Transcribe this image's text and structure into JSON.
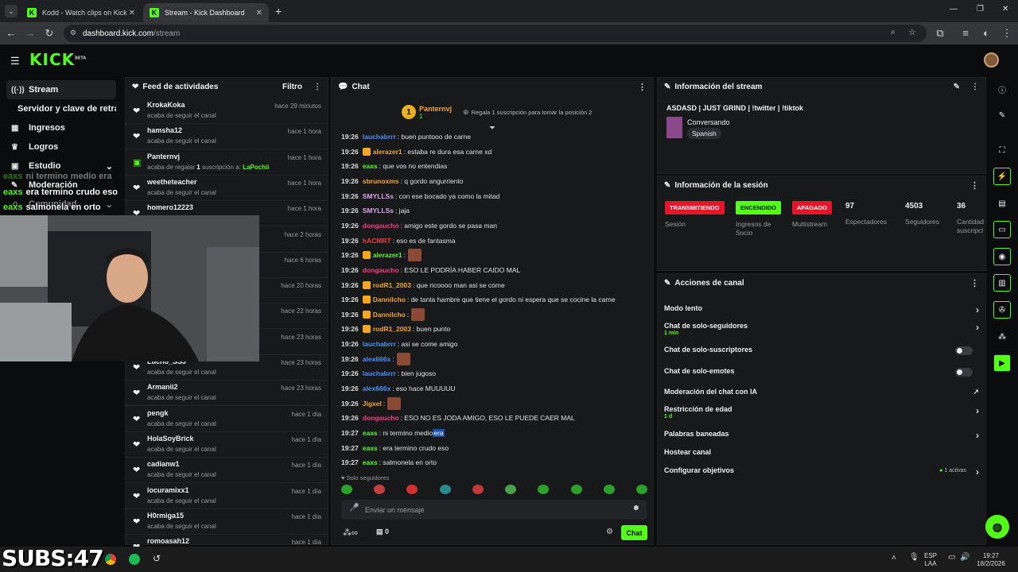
{
  "browser": {
    "tabs": [
      {
        "title": "Kodd - Watch clips on Kick"
      },
      {
        "title": "Stream - Kick Dashboard"
      }
    ],
    "url_host": "dashboard.kick.com",
    "url_path": "/stream"
  },
  "brand": {
    "logo": "KICK",
    "logo_badge": "BETA",
    "accent": "#53fc18"
  },
  "nav": {
    "items": [
      {
        "label": "Stream",
        "icon": "broadcast-icon"
      },
      {
        "label": "Servidor y clave de retransm"
      },
      {
        "label": "Ingresos",
        "icon": "chart-icon"
      },
      {
        "label": "Logros",
        "icon": "trophy-icon"
      },
      {
        "label": "Estudio",
        "icon": "studio-icon"
      },
      {
        "label": "Moderación",
        "icon": "shield-icon"
      },
      {
        "label": "Comunidad",
        "icon": "community-icon"
      }
    ]
  },
  "feed": {
    "title": "Feed de actividades",
    "filter": "Filtro",
    "items": [
      {
        "name": "KrokaKoka",
        "desc": "acaba de seguir el canal",
        "time": "hace 29 minutos"
      },
      {
        "name": "hamsha12",
        "desc": "acaba de seguir el canal",
        "time": "hace 1 hora"
      },
      {
        "name": "Panternvj",
        "desc_pre": "acaba de regalar ",
        "desc_count": "1",
        "desc_mid": " suscripción a: ",
        "desc_target": "LaPochii",
        "time": "hace 1 hora"
      },
      {
        "name": "weetheteacher",
        "desc": "acaba de seguir el canal",
        "time": "hace 1 hora"
      },
      {
        "name": "homero12223",
        "desc": "",
        "time": "hace 1 hora"
      },
      {
        "name": "",
        "desc": "",
        "time": "hace 2 horas"
      },
      {
        "name": "",
        "desc": "",
        "time": "hace 6 horas"
      },
      {
        "name": "",
        "desc": "",
        "time": "hace 20 horas"
      },
      {
        "name": "",
        "desc": "",
        "time": "hace 22 horas"
      },
      {
        "name": "",
        "desc": "",
        "time": "hace 23 horas"
      },
      {
        "name": "Lucho_SSJ",
        "desc": "acaba de seguir el canal",
        "time": "hace 23 horas"
      },
      {
        "name": "Armanii2",
        "desc": "acaba de seguir el canal",
        "time": "hace 23 horas"
      },
      {
        "name": "pengk",
        "desc": "acaba de seguir el canal",
        "time": "hace 1 día"
      },
      {
        "name": "HolaSoyBrick",
        "desc": "acaba de seguir el canal",
        "time": "hace 1 día"
      },
      {
        "name": "cadianw1",
        "desc": "acaba de seguir el canal",
        "time": "hace 1 día"
      },
      {
        "name": "locuramixx1",
        "desc": "acaba de seguir el canal",
        "time": "hace 1 día"
      },
      {
        "name": "H0rmiga15",
        "desc": "acaba de seguir el canal",
        "time": "hace 1 día"
      },
      {
        "name": "romoasah12",
        "desc": "",
        "time": "hace 1 día"
      }
    ]
  },
  "chat": {
    "title": "Chat",
    "top_gifter": {
      "name": "Panternvj",
      "rank": "1",
      "count": "1",
      "cta": "Regala 1 suscripción para tomar la posición 2"
    },
    "messages": [
      {
        "time": "19:26",
        "user": "lauchabrrr",
        "color": "#4f8ff7",
        "text": ": buen puntooo de carne"
      },
      {
        "time": "19:26",
        "user": "alerazer1",
        "color": "#f5a623",
        "text": ": estaba re dura esa carne xd",
        "badge": true
      },
      {
        "time": "19:26",
        "user": "eaxs",
        "color": "#53fc18",
        "text": ": que vos no entendias"
      },
      {
        "time": "19:26",
        "user": "sbrunoxms",
        "color": "#f5a623",
        "text": ": q gordo angurriento"
      },
      {
        "time": "19:26",
        "user": "SMYLLSs",
        "color": "#e0a0f0",
        "text": ": con ese bocado ya como la mitad"
      },
      {
        "time": "19:26",
        "user": "SMYLLSs",
        "color": "#e0a0f0",
        "text": ": jaja"
      },
      {
        "time": "19:26",
        "user": "dongaucho",
        "color": "#f04080",
        "text": ": amigo este gordo se pasa man"
      },
      {
        "time": "19:26",
        "user": "hACMRT",
        "color": "#f04040",
        "text": ": eso es de fantasma"
      },
      {
        "time": "19:26",
        "user": "alerazer1",
        "color": "#53fc18",
        "text": ":",
        "badge": true,
        "emote": true
      },
      {
        "time": "19:26",
        "user": "dongaucho",
        "color": "#f04080",
        "text": ": ESO LE PODRÍA HABER CAIDO MAL"
      },
      {
        "time": "19:26",
        "user": "rodR1_2003",
        "color": "#f5a623",
        "text": ": que ricoooo man asi se come",
        "badge": true
      },
      {
        "time": "19:26",
        "user": "Dannilcho",
        "color": "#f5a623",
        "text": ": de tanta hambre que tiene el gordo ni espera que se cocine la carne",
        "badge": true
      },
      {
        "time": "19:26",
        "user": "Dannilcho",
        "color": "#f5a623",
        "text": ":",
        "badge": true,
        "emote": true
      },
      {
        "time": "19:26",
        "user": "rodR1_2003",
        "color": "#f5a623",
        "text": ": buen punto",
        "badge": true
      },
      {
        "time": "19:26",
        "user": "lauchabrrr",
        "color": "#4f8ff7",
        "text": ": asi se come amigo"
      },
      {
        "time": "19:26",
        "user": "alex666x",
        "color": "#4f8ff7",
        "text": ":",
        "emote": true
      },
      {
        "time": "19:26",
        "user": "lauchabrrr",
        "color": "#4f8ff7",
        "text": ": bien jugoso"
      },
      {
        "time": "19:26",
        "user": "alex666x",
        "color": "#4f8ff7",
        "text": ": eso hace MUUUUU"
      },
      {
        "time": "19:26",
        "user": "Jigxel",
        "color": "#f5a623",
        "text": ":",
        "emote": true
      },
      {
        "time": "19:26",
        "user": "dongaucho",
        "color": "#f04080",
        "text": ": ESO NO ES JODA AMIGO, ESO LE PUEDE CAER MAL"
      },
      {
        "time": "19:27",
        "user": "eaxs",
        "color": "#53fc18",
        "text": ": ni termino medio ",
        "highlight": "era"
      },
      {
        "time": "19:27",
        "user": "eaxs",
        "color": "#53fc18",
        "text": ": era termino crudo eso"
      },
      {
        "time": "19:27",
        "user": "eaxs",
        "color": "#53fc18",
        "text": ": salmonela en orto"
      }
    ],
    "mode_label": "Solo seguidores",
    "input_placeholder": "Enviar un mensaje",
    "infinity": "∞",
    "gift_count": "0",
    "send": "Chat"
  },
  "stream_info": {
    "title": "Información del stream",
    "stream_title": "ASDASD | JUST GRIND | !twitter | !tiktok",
    "category": "Conversando",
    "language": "Spanish"
  },
  "session": {
    "title": "Información de la sesión",
    "badges": [
      {
        "text": "TRANSMITIENDO",
        "label": "Sesión",
        "bg": "#e3172b",
        "fg": "#ffffff"
      },
      {
        "text": "ENCENDIDO",
        "label": "Ingresos de Socio",
        "bg": "#53fc18",
        "fg": "#000000"
      },
      {
        "text": "APAGADO",
        "label": "Multistream",
        "bg": "#e3172b",
        "fg": "#ffffff"
      }
    ],
    "stats": [
      {
        "value": "97",
        "label": "Espectadores"
      },
      {
        "value": "4503",
        "label": "Seguidores"
      },
      {
        "value": "36",
        "label": "Cantidad suscripci"
      }
    ]
  },
  "actions": {
    "title": "Acciones de canal",
    "items": [
      {
        "label": "Modo lento",
        "type": "chevron"
      },
      {
        "label": "Chat de solo-seguidores",
        "sub": "1 min",
        "type": "chevron"
      },
      {
        "label": "Chat de solo-suscriptores",
        "type": "toggle"
      },
      {
        "label": "Chat de solo-emotes",
        "type": "toggle"
      },
      {
        "label": "Moderación del chat con IA",
        "type": "external"
      },
      {
        "label": "Restricción de edad",
        "sub": "1 d",
        "type": "chevron"
      },
      {
        "label": "Palabras baneadas",
        "type": "chevron"
      },
      {
        "label": "Hostear canal",
        "type": "none"
      },
      {
        "label": "Configurar objetivos",
        "type": "chevron",
        "status": "1 activas"
      }
    ]
  },
  "overlay": {
    "lines": [
      {
        "user": "eaxs",
        "sep": ": ",
        "text": "ni termino medio era"
      },
      {
        "user": "eaxs",
        "sep": ": ",
        "text": "era termino crudo eso"
      },
      {
        "user": "eaxs",
        "sep": ": ",
        "text": "salmonela en orto"
      }
    ],
    "subs": "SUBS:47"
  },
  "taskbar": {
    "lang": "ESP",
    "lang2": "LAA",
    "time": "19:27",
    "date": "18/2/2026"
  }
}
